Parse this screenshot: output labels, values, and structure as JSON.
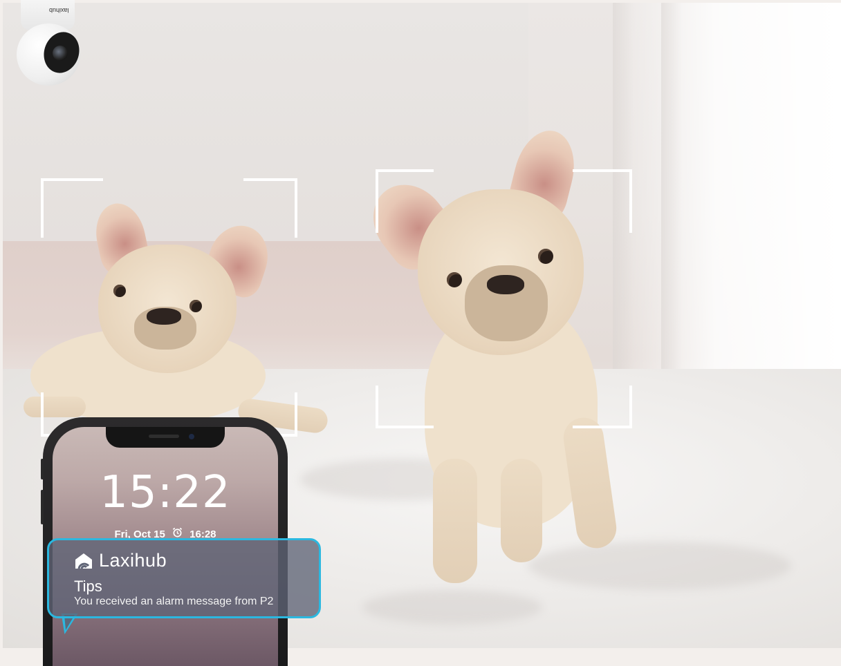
{
  "camera": {
    "logo_text": "laxihub",
    "icon": "security-camera-icon"
  },
  "phone": {
    "lock_time": "15:22",
    "lock_date": "Fri, Oct 15",
    "alarm_icon": "alarm-clock-icon",
    "alarm_time": "16:28"
  },
  "notification": {
    "brand_icon": "laxihub-logo-icon",
    "brand": "Laxihub",
    "title": "Tips",
    "message": "You received an alarm message from P2",
    "border_color": "#2bb8e0"
  },
  "detections": {
    "count": 2,
    "bracket_color": "#ffffff"
  }
}
